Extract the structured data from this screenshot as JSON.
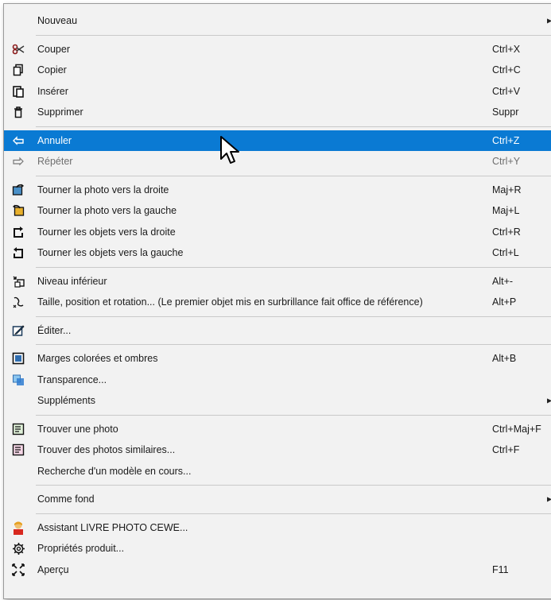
{
  "menu": {
    "groups": [
      [
        {
          "label": "Nouveau",
          "shortcut": "",
          "submenu": true,
          "icon": "none"
        }
      ],
      [
        {
          "label": "Couper",
          "shortcut": "Ctrl+X",
          "icon": "scissors-icon"
        },
        {
          "label": "Copier",
          "shortcut": "Ctrl+C",
          "icon": "copy-icon"
        },
        {
          "label": "Insérer",
          "shortcut": "Ctrl+V",
          "icon": "paste-icon"
        },
        {
          "label": "Supprimer",
          "shortcut": "Suppr",
          "icon": "trash-icon"
        }
      ],
      [
        {
          "label": "Annuler",
          "shortcut": "Ctrl+Z",
          "icon": "undo-icon",
          "highlighted": true
        },
        {
          "label": "Répéter",
          "shortcut": "Ctrl+Y",
          "icon": "redo-icon",
          "disabled": true
        }
      ],
      [
        {
          "label": "Tourner la photo vers la droite",
          "shortcut": "Maj+R",
          "icon": "rotate-photo-right-icon"
        },
        {
          "label": "Tourner la photo vers la gauche",
          "shortcut": "Maj+L",
          "icon": "rotate-photo-left-icon"
        },
        {
          "label": "Tourner les objets vers la droite",
          "shortcut": "Ctrl+R",
          "icon": "rotate-objects-right-icon"
        },
        {
          "label": "Tourner les objets vers la gauche",
          "shortcut": "Ctrl+L",
          "icon": "rotate-objects-left-icon"
        }
      ],
      [
        {
          "label": "Niveau inférieur",
          "shortcut": "Alt+-",
          "icon": "lower-level-icon"
        },
        {
          "label": "Taille, position et rotation... (Le premier objet mis en surbrillance fait office de référence)",
          "shortcut": "Alt+P",
          "icon": "transform-icon"
        }
      ],
      [
        {
          "label": "Éditer...",
          "shortcut": "",
          "icon": "edit-icon"
        }
      ],
      [
        {
          "label": "Marges colorées et ombres",
          "shortcut": "Alt+B",
          "icon": "frame-shadow-icon"
        },
        {
          "label": "Transparence...",
          "shortcut": "",
          "icon": "transparency-icon"
        },
        {
          "label": "Suppléments",
          "shortcut": "",
          "submenu": true,
          "icon": "none"
        }
      ],
      [
        {
          "label": "Trouver une photo",
          "shortcut": "Ctrl+Maj+F",
          "icon": "find-photo-icon"
        },
        {
          "label": "Trouver des photos similaires...",
          "shortcut": "Ctrl+F",
          "icon": "find-similar-icon"
        },
        {
          "label": "Recherche d'un modèle en cours...",
          "shortcut": "",
          "icon": "none"
        }
      ],
      [
        {
          "label": "Comme fond",
          "shortcut": "",
          "submenu": true,
          "icon": "none"
        }
      ],
      [
        {
          "label": "Assistant LIVRE PHOTO CEWE...",
          "shortcut": "",
          "icon": "assistant-icon"
        },
        {
          "label": "Propriétés produit...",
          "shortcut": "",
          "icon": "gear-icon"
        },
        {
          "label": "Aperçu",
          "shortcut": "F11",
          "icon": "fullscreen-icon"
        }
      ]
    ]
  },
  "colors": {
    "highlight": "#0a7ad3",
    "menu_bg": "#f2f2f2",
    "text": "#1a1a1a",
    "disabled": "#6e6e6e"
  },
  "submenu_arrow": "▶"
}
